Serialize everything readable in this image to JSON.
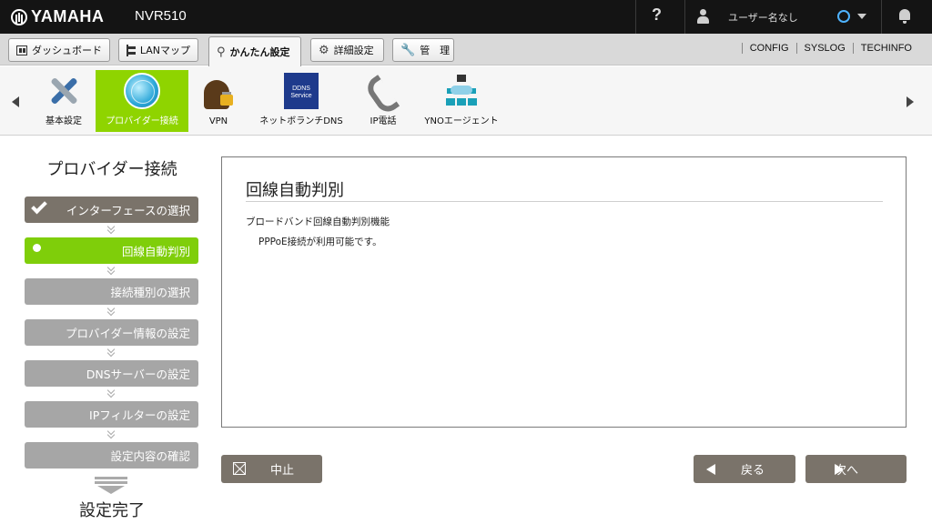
{
  "header": {
    "brand": "YAMAHA",
    "model": "NVR510",
    "help_label": "?",
    "username": "ユーザー名なし"
  },
  "menu": {
    "tabs": [
      {
        "label": "ダッシュボード"
      },
      {
        "label": "LANマップ"
      },
      {
        "label": "かんたん設定"
      },
      {
        "label": "詳細設定"
      },
      {
        "label": "管　理"
      }
    ],
    "links": [
      "CONFIG",
      "SYSLOG",
      "TECHINFO"
    ]
  },
  "functions": [
    {
      "label": "基本設定",
      "icon": "tools-icon"
    },
    {
      "label": "プロバイダー接続",
      "icon": "globe-icon"
    },
    {
      "label": "VPN",
      "icon": "vpn-lock-icon"
    },
    {
      "label": "ネットボランチDNS",
      "icon": "ddns-service-icon",
      "icon_text": "DDNS Service"
    },
    {
      "label": "IP電話",
      "icon": "phone-icon"
    },
    {
      "label": "YNOエージェント",
      "icon": "network-icon"
    }
  ],
  "steps": {
    "title": "プロバイダー接続",
    "items": [
      {
        "label": "インターフェースの選択",
        "state": "done"
      },
      {
        "label": "回線自動判別",
        "state": "current"
      },
      {
        "label": "接続種別の選択",
        "state": "pending"
      },
      {
        "label": "プロバイダー情報の設定",
        "state": "pending"
      },
      {
        "label": "DNSサーバーの設定",
        "state": "pending"
      },
      {
        "label": "IPフィルターの設定",
        "state": "pending"
      },
      {
        "label": "設定内容の確認",
        "state": "pending"
      }
    ],
    "finish": "設定完了"
  },
  "main": {
    "title": "回線自動判別",
    "description": "ブロードバンド回線自動判別機能",
    "result": "PPPoE接続が利用可能です。"
  },
  "buttons": {
    "cancel": "中止",
    "back": "戻る",
    "next": "次へ"
  },
  "colors": {
    "accent_green": "#8fd400",
    "step_done": "#7a736a",
    "step_pending": "#a6a6a6",
    "topbar": "#141414"
  }
}
